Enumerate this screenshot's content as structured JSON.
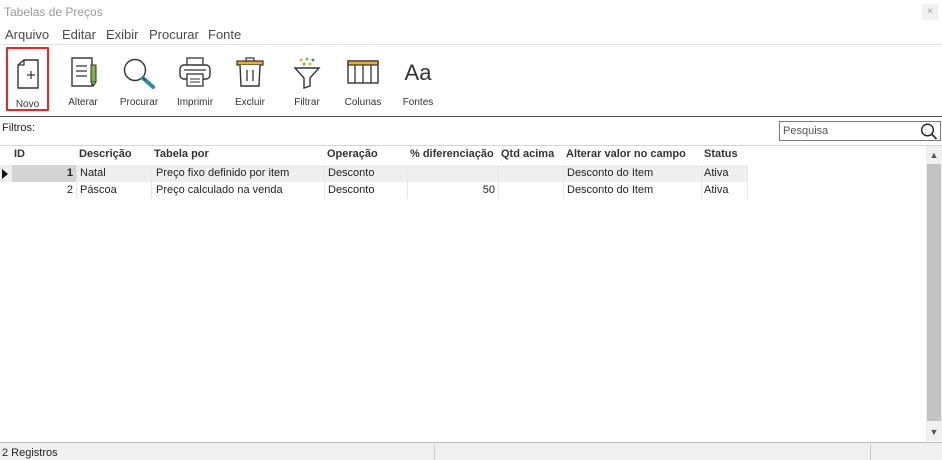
{
  "window": {
    "title": "Tabelas de Preços",
    "close_glyph": "×"
  },
  "menu": [
    "Arquivo",
    "Editar",
    "Exibir",
    "Procurar",
    "Fonte"
  ],
  "toolbar": {
    "novo": "Novo",
    "alterar": "Alterar",
    "procurar": "Procurar",
    "imprimir": "Imprimir",
    "excluir": "Excluir",
    "filtrar": "Filtrar",
    "colunas": "Colunas",
    "fontes": "Fontes",
    "fontes_glyph": "Aa",
    "accent_color": "#e5262b"
  },
  "filters": {
    "label": "Filtros:",
    "search_placeholder": "Pesquisa"
  },
  "table": {
    "columns": [
      "ID",
      "Descrição",
      "Tabela por",
      "Operação",
      "% diferenciação",
      "Qtd acima",
      "Alterar valor no campo",
      "Status"
    ],
    "rows": [
      {
        "id": "1",
        "descricao": "Natal",
        "tabela_por": "Preço fixo definido por item",
        "operacao": "Desconto",
        "diferenciacao": "",
        "qtd_acima": "",
        "alterar_valor": "Desconto do Item",
        "status": "Ativa"
      },
      {
        "id": "2",
        "descricao": "Páscoa",
        "tabela_por": "Preço calculado na venda",
        "operacao": "Desconto",
        "diferenciacao": "50",
        "qtd_acima": "",
        "alterar_valor": "Desconto do Item",
        "status": "Ativa"
      }
    ]
  },
  "scroll": {
    "up_glyph": "▲",
    "down_glyph": "▼"
  },
  "status": {
    "records": "2 Registros"
  }
}
